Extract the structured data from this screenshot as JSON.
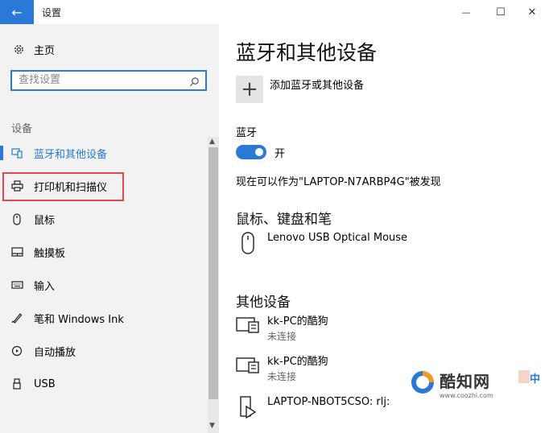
{
  "window": {
    "title": "设置",
    "back": "←",
    "minimize": "—",
    "maximize": "☐",
    "close": "✕"
  },
  "sidebar": {
    "home": "主页",
    "search_placeholder": "查找设置",
    "section": "设备",
    "items": [
      {
        "label": "蓝牙和其他设备",
        "icon": "bluetooth-devices-icon"
      },
      {
        "label": "打印机和扫描仪",
        "icon": "printer-icon"
      },
      {
        "label": "鼠标",
        "icon": "mouse-icon"
      },
      {
        "label": "触摸板",
        "icon": "touchpad-icon"
      },
      {
        "label": "输入",
        "icon": "keyboard-icon"
      },
      {
        "label": "笔和 Windows Ink",
        "icon": "pen-icon"
      },
      {
        "label": "自动播放",
        "icon": "autoplay-icon"
      },
      {
        "label": "USB",
        "icon": "usb-icon"
      }
    ]
  },
  "main": {
    "title": "蓝牙和其他设备",
    "add_label": "添加蓝牙或其他设备",
    "bluetooth_label": "蓝牙",
    "toggle_label": "开",
    "discoverable": "现在可以作为\"LAPTOP-N7ARBP4G\"被发现",
    "mouse_section": "鼠标、键盘和笔",
    "mouse_device": "Lenovo USB Optical Mouse",
    "other_section": "其他设备",
    "other_devices": [
      {
        "name": "kk-PC的酷狗",
        "status": "未连接"
      },
      {
        "name": "kk-PC的酷狗",
        "status": "未连接"
      },
      {
        "name": "LAPTOP-NBOT5CSO: rlj:",
        "status": ""
      }
    ]
  },
  "watermark": {
    "brand": "酷知网",
    "url": "www.coozhi.com",
    "side": "中"
  },
  "colors": {
    "accent": "#2b79d6",
    "highlight": "#e0474e",
    "sidebar": "#f2f2f2"
  }
}
